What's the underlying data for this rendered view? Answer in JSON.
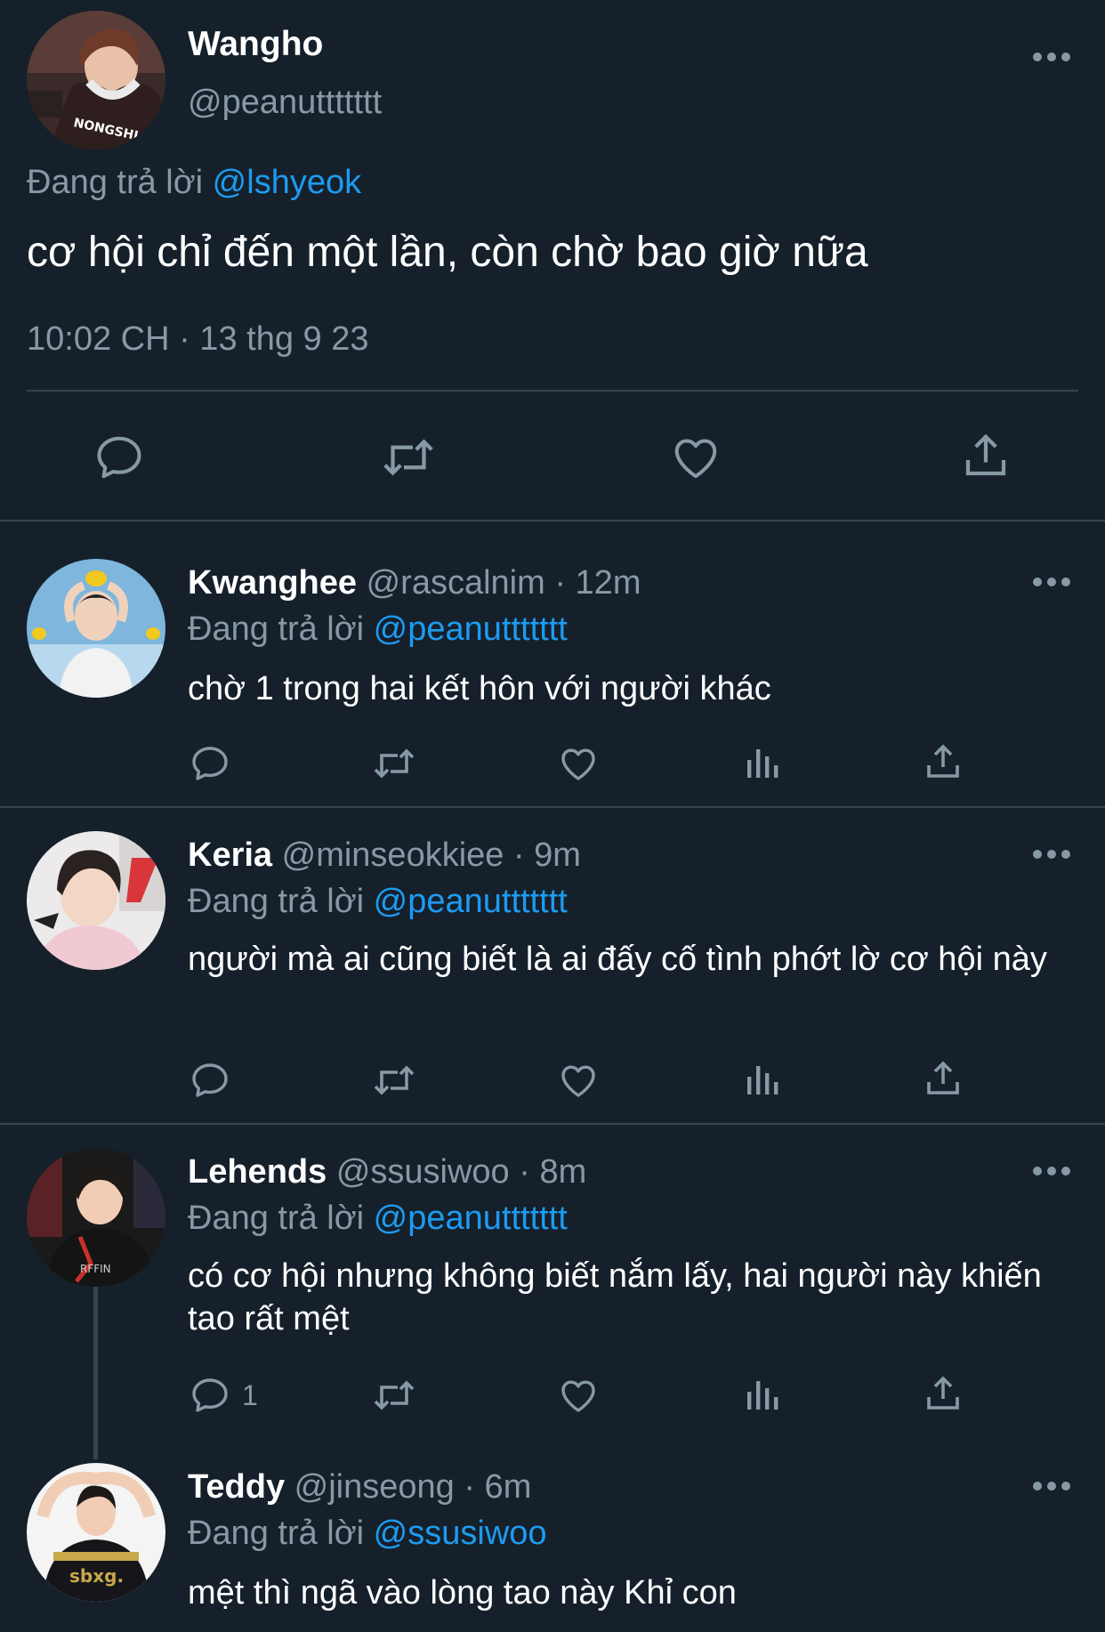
{
  "main_tweet": {
    "name": "Wangho",
    "handle": "@peanuttttttt",
    "replying_prefix": "Đang trả lời",
    "replying_to": "@lshyeok",
    "text": "cơ hội chỉ đến một lần, còn chờ bao giờ nữa",
    "timestamp": "10:02 CH · 13 thg 9 23",
    "avatar_shirt_text": "NONGSHI"
  },
  "replies": [
    {
      "name": "Kwanghee",
      "meta": "@rascalnim · 12m",
      "replying_prefix": "Đang trả lời",
      "replying_to": "@peanuttttttt",
      "text": "chờ 1 trong hai kết hôn với người khác",
      "reply_count": ""
    },
    {
      "name": "Keria",
      "meta": "@minseokkiee · 9m",
      "replying_prefix": "Đang trả lời",
      "replying_to": "@peanuttttttt",
      "text": "người mà ai cũng biết là ai đấy cố tình phớt lờ cơ hội này",
      "reply_count": ""
    },
    {
      "name": "Lehends",
      "meta": "@ssusiwoo · 8m",
      "replying_prefix": "Đang trả lời",
      "replying_to": "@peanuttttttt",
      "text": "có cơ hội nhưng không biết nắm lấy, hai người này khiến tao rất mệt",
      "reply_count": "1"
    },
    {
      "name": "Teddy",
      "meta": "@jinseong · 6m",
      "replying_prefix": "Đang trả lời",
      "replying_to": "@ssusiwoo",
      "text": "mệt thì ngã vào lòng tao này Khỉ con",
      "reply_count": ""
    }
  ],
  "colors": {
    "background": "#15202b",
    "muted_text": "#8899a6",
    "link": "#1d9bf0",
    "divider": "#38444d"
  },
  "icons": [
    "reply-icon",
    "retweet-icon",
    "like-icon",
    "views-icon",
    "share-icon",
    "more-icon"
  ]
}
